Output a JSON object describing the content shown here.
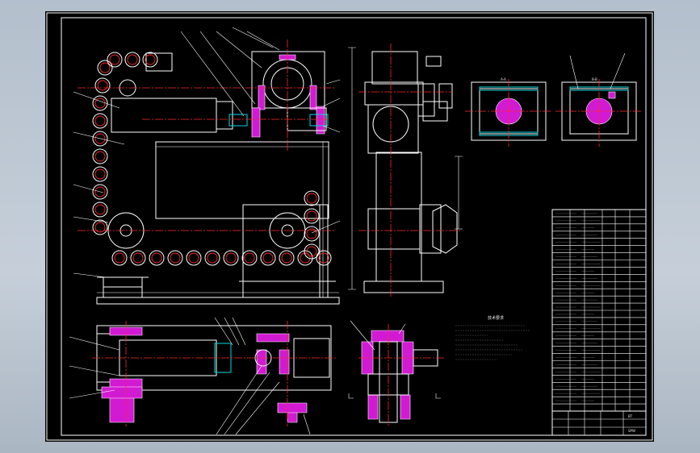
{
  "drawing": {
    "title_text": "",
    "notes_heading": "技术要求",
    "section_labels": [
      "A-A",
      "B-B"
    ],
    "title_block_codes": [
      "BT",
      "SPW"
    ]
  },
  "colors": {
    "background_outer": "#b9c4cf",
    "sheet": "#000000",
    "outline": "#ffffff",
    "centerline": "#ff2a2a",
    "section_fill": "#d21ad2",
    "highlight": "#00d7e0"
  },
  "views": [
    {
      "id": "front-view",
      "name": "chain-conveyor-front-elevation"
    },
    {
      "id": "side-view",
      "name": "gearbox-side-elevation"
    },
    {
      "id": "plan-view",
      "name": "drive-plan-section"
    },
    {
      "id": "detail-a",
      "name": "bearing-housing-detail-left"
    },
    {
      "id": "detail-b",
      "name": "bearing-housing-detail-right"
    },
    {
      "id": "section-view",
      "name": "shaft-section-detail"
    }
  ],
  "parts_list": {
    "rows": 28,
    "columns": 6
  }
}
